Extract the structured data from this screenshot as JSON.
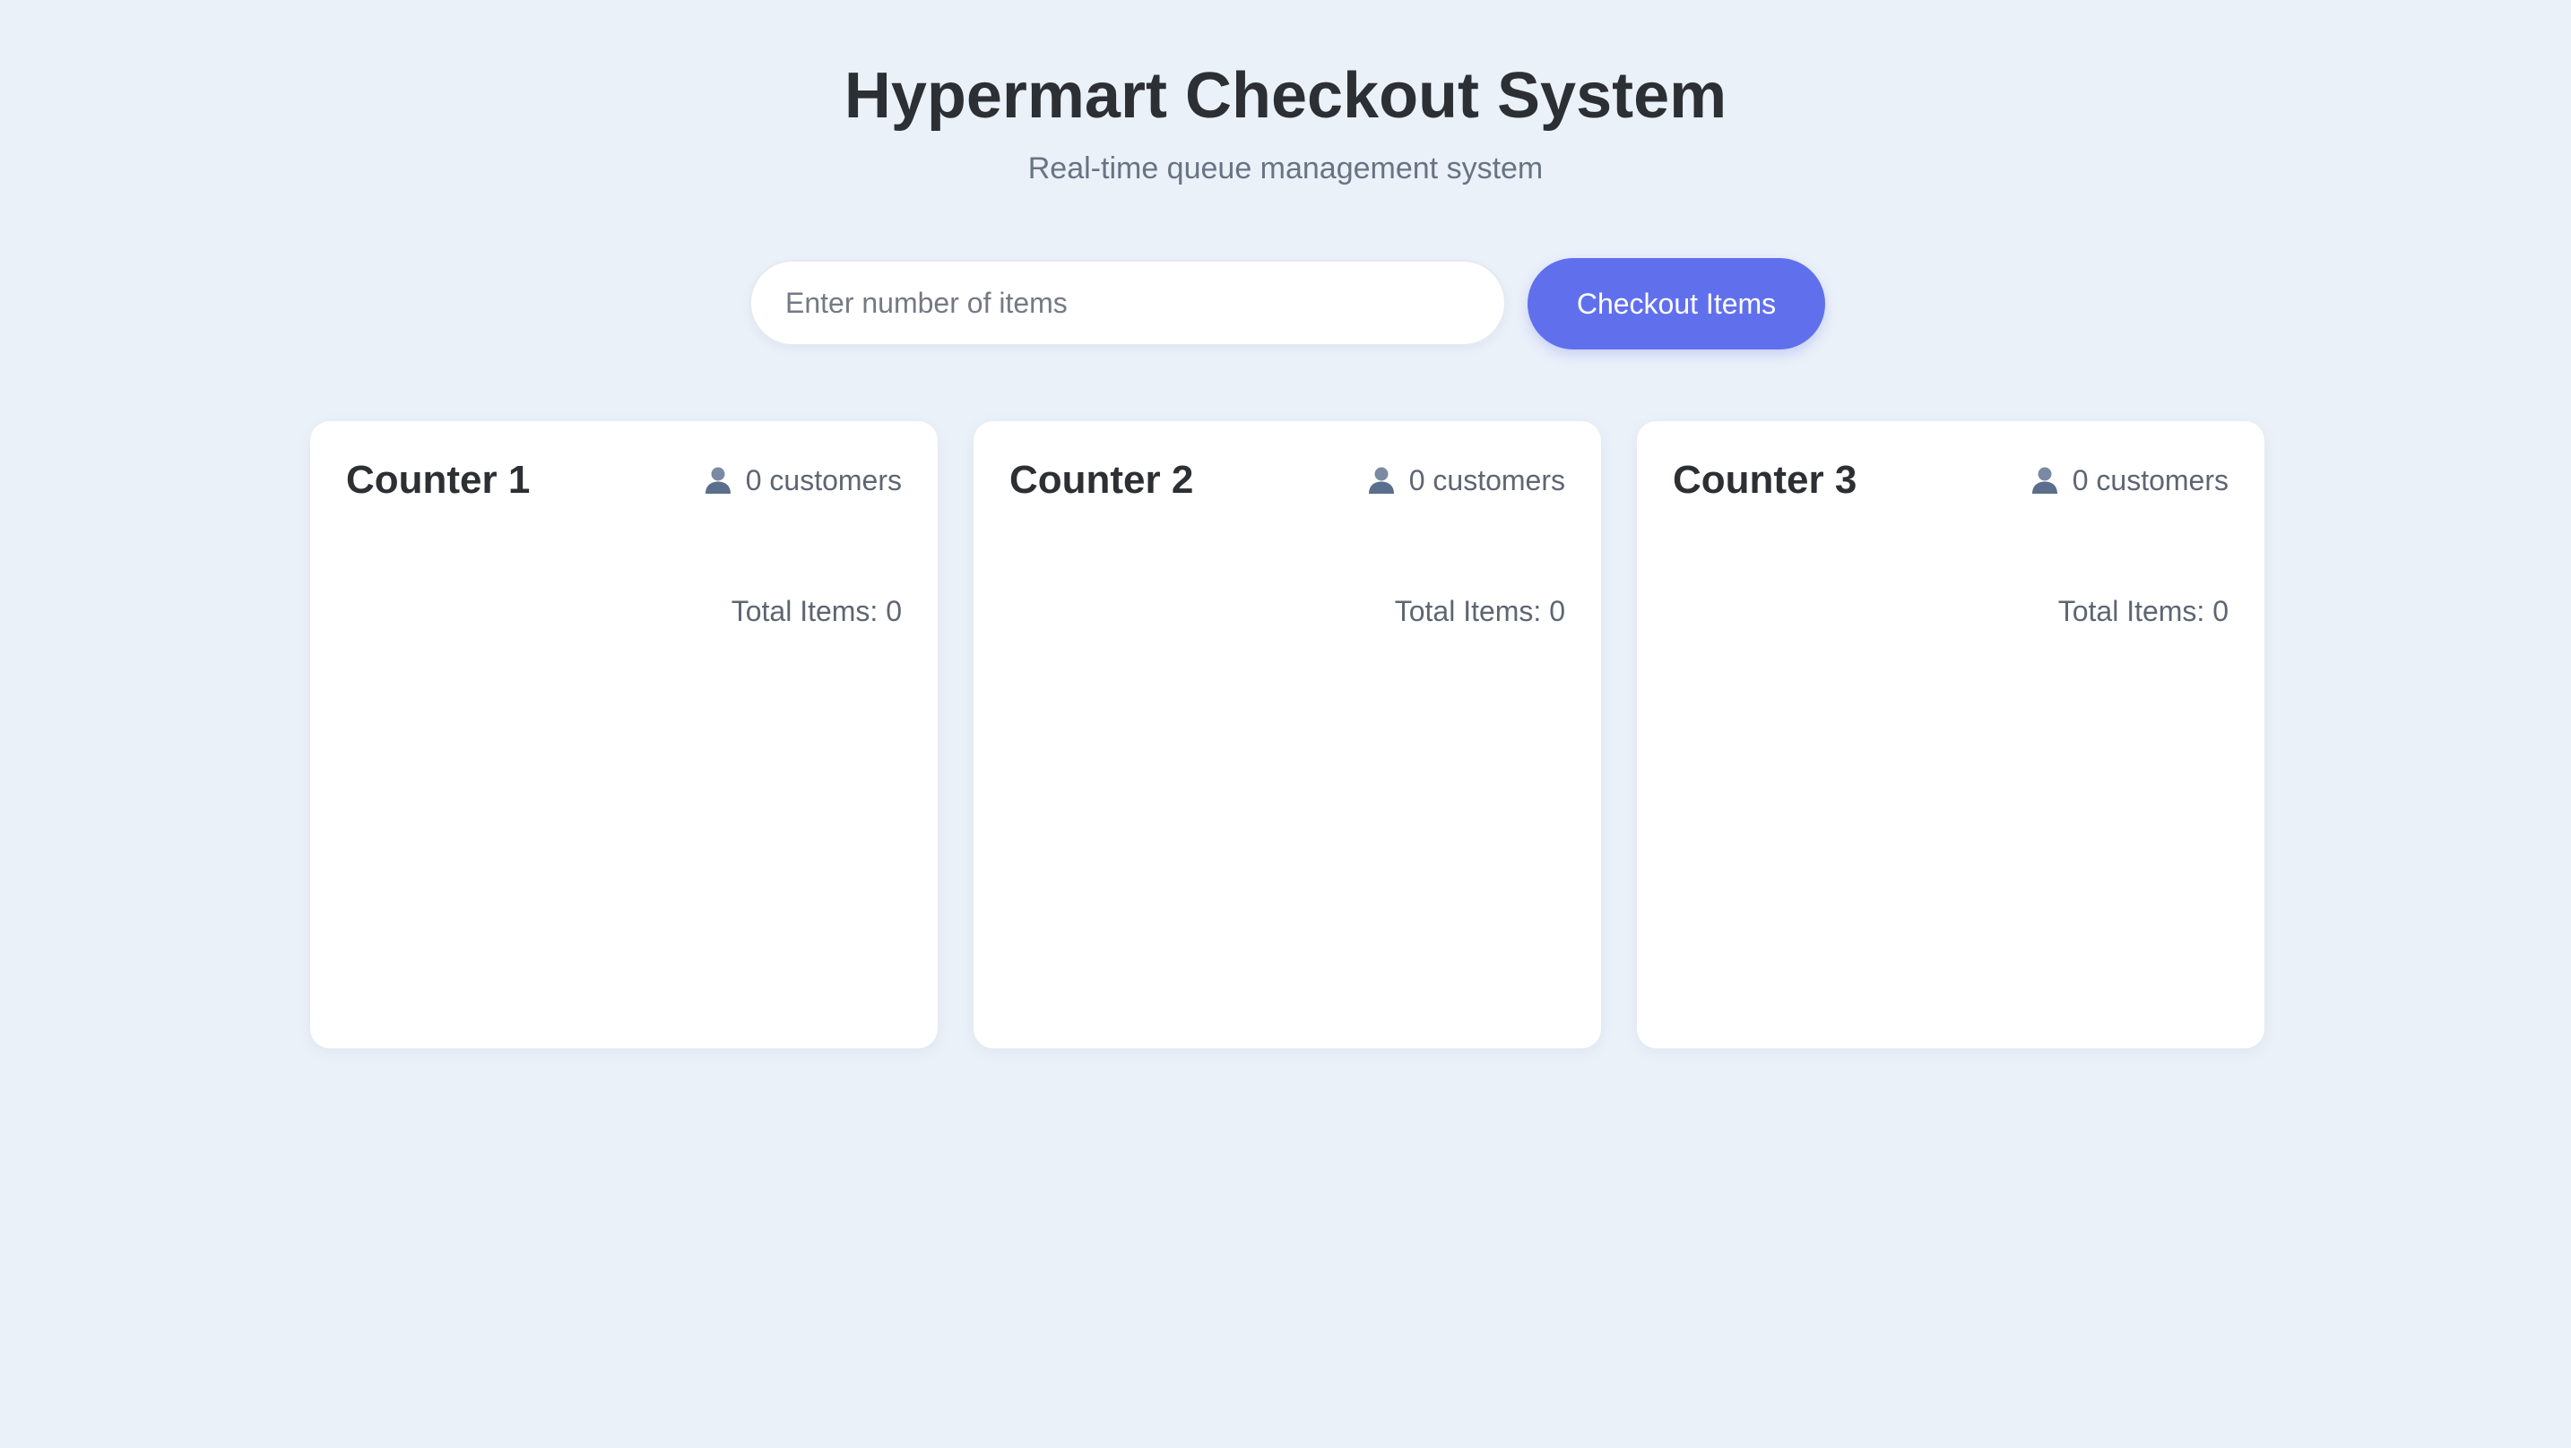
{
  "header": {
    "title": "Hypermart Checkout System",
    "subtitle": "Real-time queue management system"
  },
  "controls": {
    "items_input_value": "",
    "items_input_placeholder": "Enter number of items",
    "checkout_label": "Checkout Items"
  },
  "counters": [
    {
      "name": "Counter 1",
      "customers_label": "0 customers",
      "icon": "person-icon",
      "total_items_label": "Total Items: 0"
    },
    {
      "name": "Counter 2",
      "customers_label": "0 customers",
      "icon": "person-icon",
      "total_items_label": "Total Items: 0"
    },
    {
      "name": "Counter 3",
      "customers_label": "0 customers",
      "icon": "person-icon",
      "total_items_label": "Total Items: 0"
    }
  ],
  "colors": {
    "background": "#ebf1f9",
    "accent": "#6070ed",
    "card": "#ffffff",
    "title_text": "#2c2f33",
    "muted_text": "#5d6672"
  }
}
